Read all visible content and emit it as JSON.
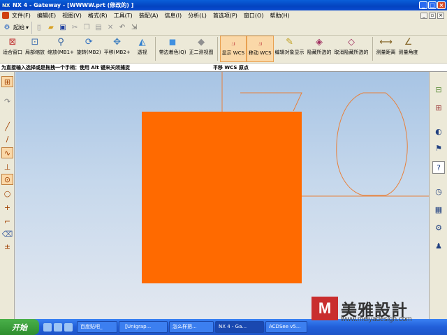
{
  "window": {
    "title": "NX 4 - Gateway - [WWWW.prt  (修改的) ]",
    "logo": "NX"
  },
  "menu": {
    "items": [
      "文件(F)",
      "编辑(E)",
      "视图(V)",
      "格式(R)",
      "工具(T)",
      "装配(A)",
      "信息(I)",
      "分析(L)",
      "首选项(P)",
      "窗口(O)",
      "帮助(H)"
    ]
  },
  "toolbar1": {
    "start_label": "起始"
  },
  "toolbar2": {
    "buttons": [
      {
        "label": "适合窗口",
        "icon": "fit-window-icon"
      },
      {
        "label": "局部缩放",
        "icon": "zoom-region-icon"
      },
      {
        "label": "缩放(MB1+",
        "icon": "zoom-icon"
      },
      {
        "label": "旋转(MB2)",
        "icon": "rotate-icon"
      },
      {
        "label": "平移(MB2+",
        "icon": "pan-icon"
      },
      {
        "label": "透视",
        "icon": "perspective-icon"
      },
      {
        "label": "带边着色(Q)",
        "icon": "shaded-edges-icon"
      },
      {
        "label": "正二测视图",
        "icon": "dimetric-view-icon"
      },
      {
        "label": "显示 WCS",
        "icon": "show-wcs-icon",
        "active": true
      },
      {
        "label": "移动 WCS",
        "icon": "move-wcs-icon",
        "active": true
      },
      {
        "label": "编辑对象显示",
        "icon": "edit-display-icon"
      },
      {
        "label": "隐藏所选的",
        "icon": "hide-selected-icon"
      },
      {
        "label": "取消隐藏所选的",
        "icon": "unhide-selected-icon"
      },
      {
        "label": "测量距离",
        "icon": "measure-distance-icon"
      },
      {
        "label": "测量角度",
        "icon": "measure-angle-icon"
      }
    ]
  },
  "status": {
    "prompt": "为直接输入选择或是拖拽一个手柄：使用 Alt 键来关闭捕捉",
    "mode": "平移 WCS 原点"
  },
  "taskbar": {
    "start": "开始",
    "tasks": [
      {
        "label": "百度贴吧_",
        "active": false
      },
      {
        "label": "【Unigrap...",
        "active": false
      },
      {
        "label": "怎么样把...",
        "active": false
      },
      {
        "label": "NX 4 - Ga...",
        "active": true
      },
      {
        "label": "ACDSee v5...",
        "active": false
      }
    ]
  },
  "watermark": {
    "logo_letter": "M",
    "title": "美雅設計",
    "url": "www.meiyadesign.com"
  },
  "colors": {
    "sketch_fill": "#ff6a00",
    "sketch_line": "#e8803a",
    "active_button": "#fad8a8"
  }
}
